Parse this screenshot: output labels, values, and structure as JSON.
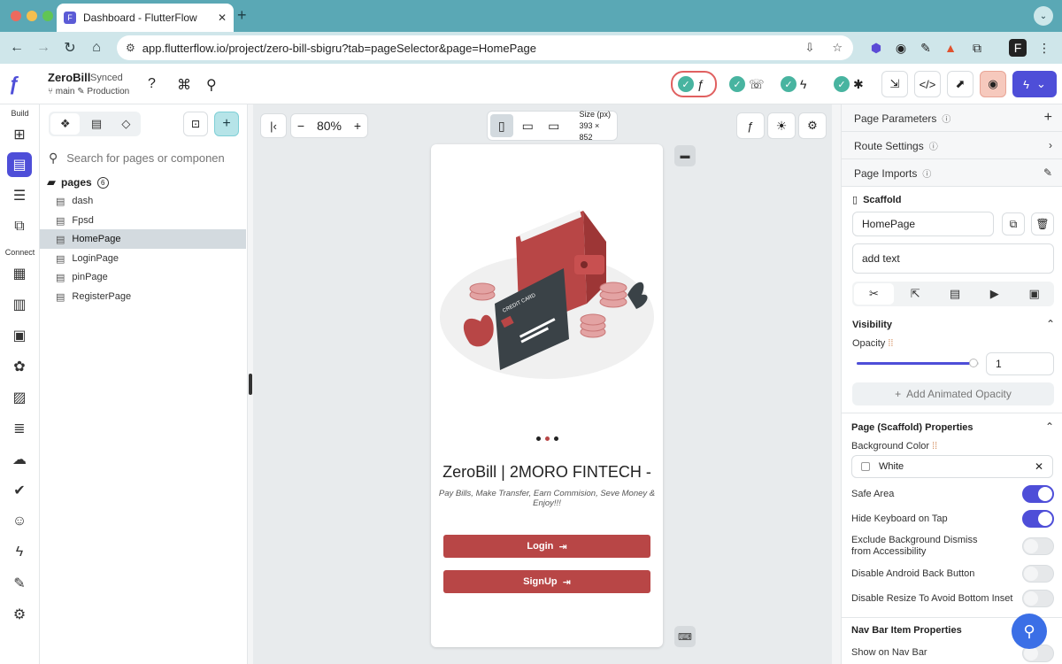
{
  "browser": {
    "tab_title": "Dashboard - FlutterFlow",
    "url": "app.flutterflow.io/project/zero-bill-sbigru?tab=pageSelector&page=HomePage"
  },
  "header": {
    "project_name": "ZeroBill",
    "sync_status": "Synced",
    "branch": "main",
    "environment": "Production"
  },
  "rail": {
    "build_label": "Build",
    "connect_label": "Connect"
  },
  "pages_panel": {
    "search_placeholder": "Search for pages or componen...",
    "folder_name": "pages",
    "folder_count": "6",
    "items": [
      {
        "label": "dash"
      },
      {
        "label": "Fpsd"
      },
      {
        "label": "HomePage"
      },
      {
        "label": "LoginPage"
      },
      {
        "label": "pinPage"
      },
      {
        "label": "RegisterPage"
      }
    ]
  },
  "canvas": {
    "zoom": "80%",
    "size_label": "Size (px)",
    "size_value": "393 × 852"
  },
  "phone": {
    "title": "ZeroBill | 2MORO FINTECH -",
    "subtitle": "Pay Bills, Make Transfer, Earn Commision, Seve Money & Enjoy!!!",
    "login_label": "Login",
    "signup_label": "SignUp",
    "card_text": "CREDIT CARD",
    "accent_color": "#b84646"
  },
  "properties": {
    "page_parameters": "Page Parameters",
    "route_settings": "Route Settings",
    "page_imports": "Page Imports",
    "scaffold": "Scaffold",
    "page_name": "HomePage",
    "add_text": "add text",
    "visibility": "Visibility",
    "opacity_label": "Opacity",
    "opacity_value": "1",
    "opacity_fraction": 0.96,
    "add_animated_opacity": "Add Animated Opacity",
    "scaffold_props": "Page (Scaffold) Properties",
    "bg_color_label": "Background Color",
    "bg_color_value": "White",
    "toggles": [
      {
        "label": "Safe Area",
        "on": true
      },
      {
        "label": "Hide Keyboard on Tap",
        "on": true
      },
      {
        "label": "Exclude Background Dismiss from Accessibility",
        "on": false
      },
      {
        "label": "Disable Android Back Button",
        "on": false
      },
      {
        "label": "Disable Resize To Avoid Bottom Inset",
        "on": false
      }
    ],
    "nav_bar_props": "Nav Bar Item Properties",
    "show_on_nav_bar": "Show on Nav Bar"
  }
}
